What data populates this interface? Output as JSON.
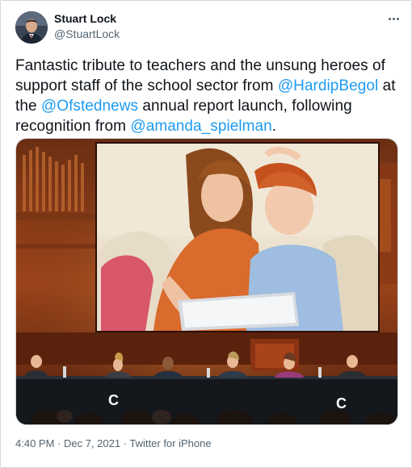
{
  "author": {
    "name": "Stuart Lock",
    "handle": "@StuartLock",
    "avatar_icon": "profile-photo"
  },
  "menu_icon": "more-dots-icon",
  "tweet": {
    "t1": "Fantastic tribute to teachers and the unsung heroes of support staff of the school sector from ",
    "m1": "@HardipBegol",
    "t2": " at the ",
    "m2": "@Ofstednews",
    "t3": " annual report launch, following recognition from ",
    "m3": "@amanda_spielman",
    "t4": "."
  },
  "footer": {
    "time": "4:40 PM",
    "sep1": " · ",
    "date": "Dec 7, 2021",
    "sep2": " · ",
    "source": "Twitter for iPhone"
  },
  "colors": {
    "link": "#1d9bf0",
    "secondary_text": "#536471",
    "primary_text": "#0f1419"
  }
}
